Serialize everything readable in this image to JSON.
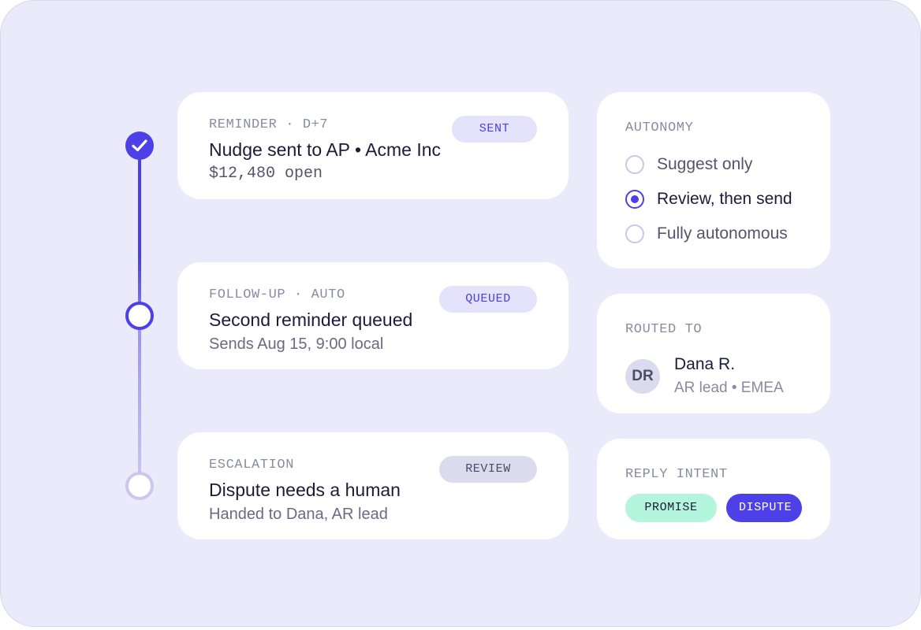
{
  "timeline": {
    "steps": [
      {
        "kicker": "REMINDER · D+7",
        "title": "Nudge sent to AP • Acme Inc",
        "detail": "$12,480 open",
        "status": "SENT",
        "state": "done"
      },
      {
        "kicker": "FOLLOW-UP · AUTO",
        "title": "Second reminder queued",
        "detail": "Sends Aug 15, 9:00 local",
        "status": "QUEUED",
        "state": "active"
      },
      {
        "kicker": "ESCALATION",
        "title": "Dispute needs a human",
        "detail": "Handed to Dana, AR lead",
        "status": "REVIEW",
        "state": "pending"
      }
    ]
  },
  "autonomy": {
    "heading": "AUTONOMY",
    "options": [
      {
        "label": "Suggest only",
        "selected": false
      },
      {
        "label": "Review, then send",
        "selected": true
      },
      {
        "label": "Fully autonomous",
        "selected": false
      }
    ]
  },
  "routed": {
    "heading": "ROUTED TO",
    "initials": "DR",
    "name": "Dana R.",
    "role": "AR lead • EMEA"
  },
  "intent": {
    "heading": "REPLY INTENT",
    "chips": [
      "PROMISE",
      "DISPUTE"
    ]
  },
  "colors": {
    "accent": "#4c40e6",
    "background": "#ebeafa",
    "promise": "#b3f5dd"
  },
  "icons": {
    "done_node": "check-icon"
  }
}
